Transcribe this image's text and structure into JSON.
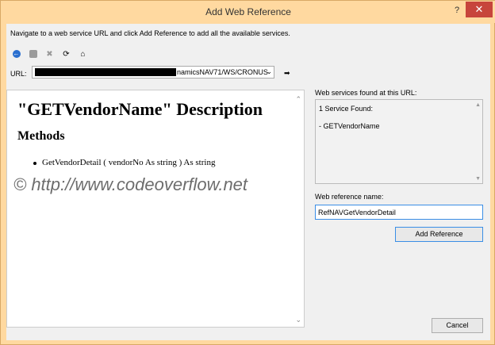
{
  "window": {
    "title": "Add Web Reference",
    "help_label": "?",
    "close_label": "✕"
  },
  "instructions": "Navigate to a web service URL and click Add Reference to add all the available services.",
  "toolbar": {
    "back_glyph": "←",
    "forward_glyph": "",
    "stop_glyph": "✖",
    "refresh_glyph": "⟳",
    "home_glyph": "⌂"
  },
  "url": {
    "label": "URL:",
    "value_visible_suffix": "namicsNAV71/WS/CRONUS",
    "dropdown_glyph": "⌄",
    "go_glyph": "➡"
  },
  "description": {
    "title": "\"GETVendorName\" Description",
    "methods_heading": "Methods",
    "method": "GetVendorDetail ( vendorNo As string ) As string",
    "scroll_up": "⌃",
    "scroll_down": "⌄"
  },
  "watermark": "©  http://www.codeoverflow.net",
  "services": {
    "label": "Web services found at this URL:",
    "count_text": "1 Service Found:",
    "items": [
      "- GETVendorName"
    ],
    "scroll_up": "▲",
    "scroll_down": "▼"
  },
  "reference": {
    "label": "Web reference name:",
    "value": "RefNAVGetVendorDetail"
  },
  "buttons": {
    "add_reference": "Add Reference",
    "cancel": "Cancel"
  }
}
